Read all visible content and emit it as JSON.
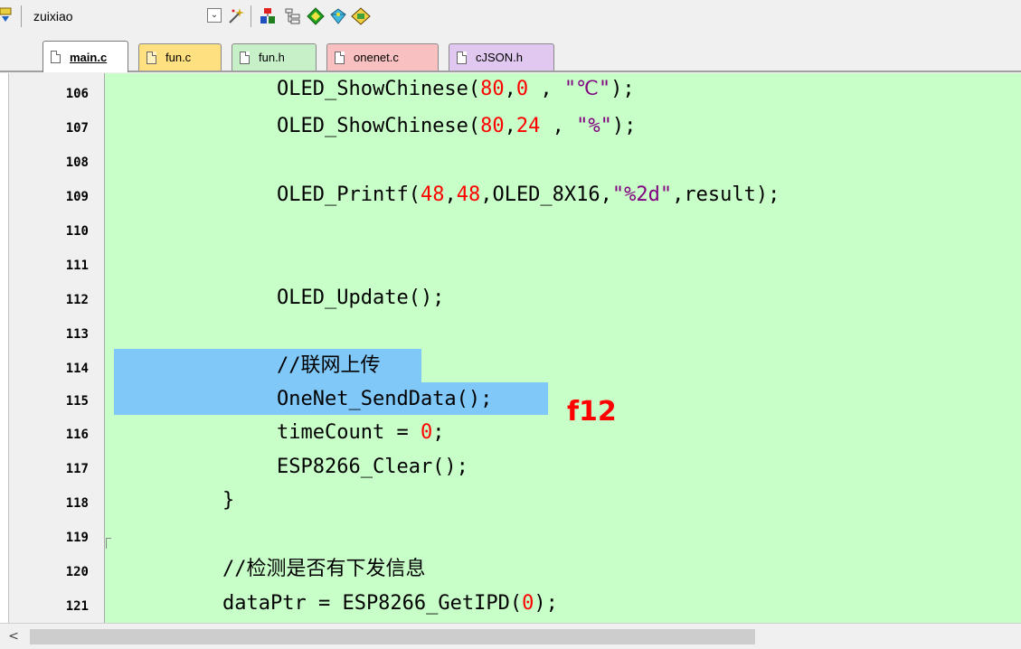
{
  "toolbar": {
    "target": "zuixiao",
    "icons": [
      "load-icon",
      "dropdown-arrow-icon",
      "options-wand-icon",
      "manage-components-icon",
      "file-extensions-icon",
      "green-diamond-icon",
      "pack-installer-icon",
      "rte-icon"
    ]
  },
  "tabs": [
    {
      "label": "main.c",
      "color": "#ffffff",
      "active": true
    },
    {
      "label": "fun.c",
      "color": "#ffe080"
    },
    {
      "label": "fun.h",
      "color": "#c8f0c8"
    },
    {
      "label": "onenet.c",
      "color": "#f8c0c0"
    },
    {
      "label": "cJSON.h",
      "color": "#e0c8f0"
    }
  ],
  "editor": {
    "background": "#c8ffc8",
    "selection_color": "#80c8f8",
    "line_numbers": [
      "106",
      "107",
      "108",
      "109",
      "110",
      "111",
      "112",
      "113",
      "114",
      "115",
      "116",
      "117",
      "118",
      "119",
      "120",
      "121"
    ],
    "code": {
      "l106": {
        "a": "OLED_ShowChinese(",
        "n1": "80",
        "b": ",",
        "n2": "0",
        "c": " , ",
        "s": "\"℃\"",
        "d": ");"
      },
      "l107": {
        "a": "OLED_ShowChinese(",
        "n1": "80",
        "b": ",",
        "n2": "24",
        "c": " , ",
        "s": "\"%\"",
        "d": ");"
      },
      "l109": {
        "a": "OLED_Printf(",
        "n1": "48",
        "b": ",",
        "n2": "48",
        "c": ",OLED_8X16,",
        "s": "\"%2d\"",
        "d": ",result);"
      },
      "l112": "OLED_Update();",
      "l114": "//联网上传",
      "l115": "OneNet_SendData();",
      "l116": {
        "a": "timeCount = ",
        "n": "0",
        "b": ";"
      },
      "l117": "ESP8266_Clear();",
      "l118": "}",
      "l120": "//检测是否有下发信息",
      "l121": {
        "a": "dataPtr = ESP8266_GetIPD(",
        "n": "0",
        "b": ");"
      }
    },
    "annotation": "f12"
  },
  "scrollbar": {
    "left_arrow": "<"
  }
}
